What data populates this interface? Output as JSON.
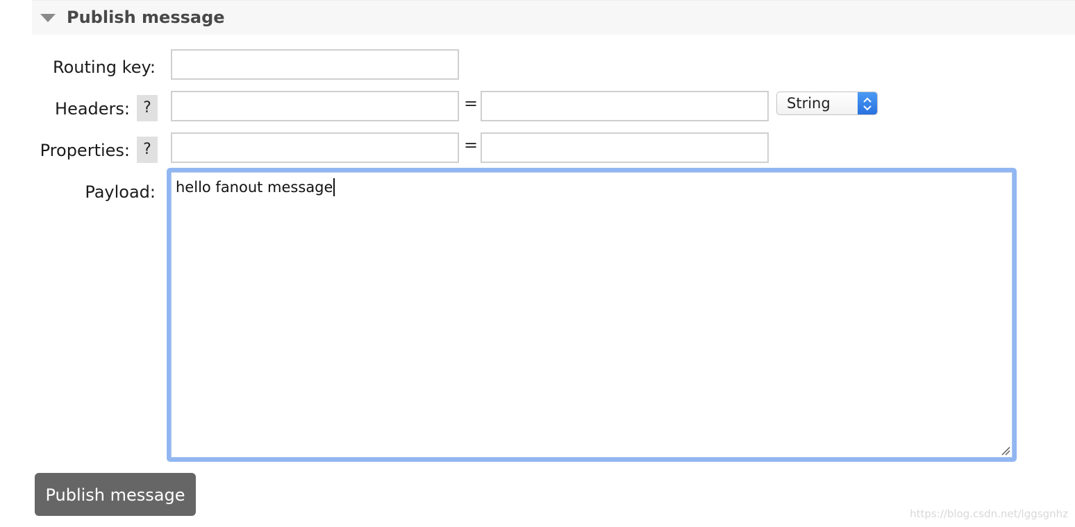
{
  "section": {
    "title": "Publish message",
    "collapse_icon": "triangle-down-icon"
  },
  "form": {
    "routing_key_label": "Routing key:",
    "routing_key_value": "",
    "headers_label": "Headers:",
    "headers_help": "?",
    "header_key_value": "",
    "header_value_value": "",
    "headers_equals": "=",
    "header_type_selected": "String",
    "properties_label": "Properties:",
    "properties_help": "?",
    "property_key_value": "",
    "property_value_value": "",
    "properties_equals": "=",
    "payload_label": "Payload:",
    "payload_value": "hello fanout message"
  },
  "actions": {
    "publish_label": "Publish message"
  },
  "watermark": "https://blog.csdn.net/lggsgnhz",
  "colors": {
    "button_bg": "#666666",
    "focus_ring": "#91b6f1",
    "select_accent": "#2a72e0"
  }
}
